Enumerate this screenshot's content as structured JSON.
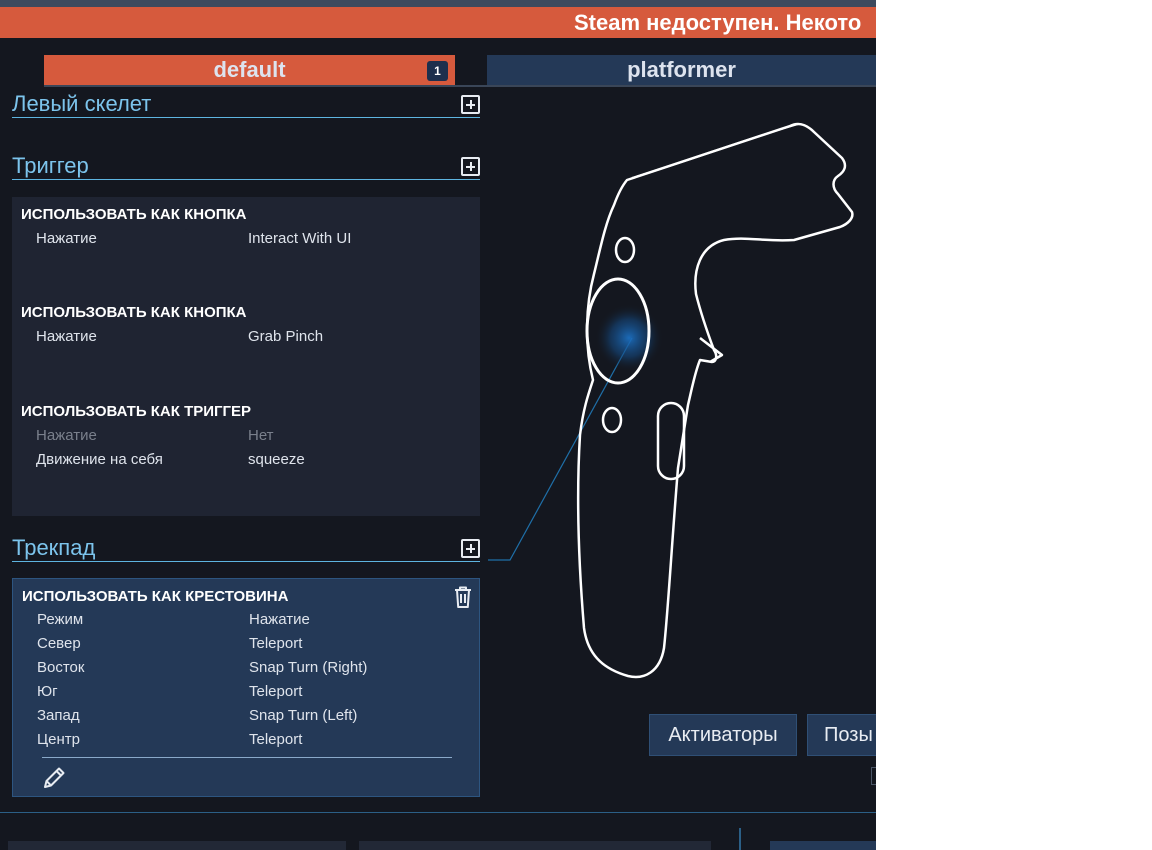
{
  "banner": {
    "text": "Steam недоступен. Некото"
  },
  "tabs": [
    {
      "label": "default",
      "badge": "1",
      "active": true
    },
    {
      "label": "platformer",
      "active": false
    }
  ],
  "sections": {
    "left_skeleton": {
      "title": "Левый скелет"
    },
    "trigger": {
      "title": "Триггер",
      "bindings": [
        {
          "heading": "ИСПОЛЬЗОВАТЬ КАК КНОПКА",
          "rows": [
            {
              "label": "Нажатие",
              "value": "Interact With UI"
            }
          ]
        },
        {
          "heading": "ИСПОЛЬЗОВАТЬ КАК КНОПКА",
          "rows": [
            {
              "label": "Нажатие",
              "value": "Grab Pinch"
            }
          ]
        },
        {
          "heading": "ИСПОЛЬЗОВАТЬ КАК ТРИГГЕР",
          "rows": [
            {
              "label": "Нажатие",
              "value": "Нет"
            },
            {
              "label": "Движение на себя",
              "value": "squeeze"
            }
          ]
        }
      ]
    },
    "trackpad": {
      "title": "Трекпад",
      "binding": {
        "heading": "ИСПОЛЬЗОВАТЬ КАК КРЕСТОВИНА",
        "rows": [
          {
            "label": "Режим",
            "value": "Нажатие"
          },
          {
            "label": "Север",
            "value": "Teleport"
          },
          {
            "label": "Восток",
            "value": "Snap Turn (Right)"
          },
          {
            "label": "Юг",
            "value": "Teleport"
          },
          {
            "label": "Запад",
            "value": "Snap Turn (Left)"
          },
          {
            "label": "Центр",
            "value": "Teleport"
          }
        ]
      }
    }
  },
  "buttons": {
    "activators": "Активаторы",
    "positions": "Позы"
  },
  "icons": {
    "add": "plus-square-icon",
    "delete": "trash-icon",
    "edit": "pencil-icon"
  },
  "colors": {
    "accent_orange": "#d65a3d",
    "section_blue": "#7cc4ec",
    "panel_dark": "#1f2432",
    "panel_selected": "#243957",
    "background": "#14171f"
  }
}
